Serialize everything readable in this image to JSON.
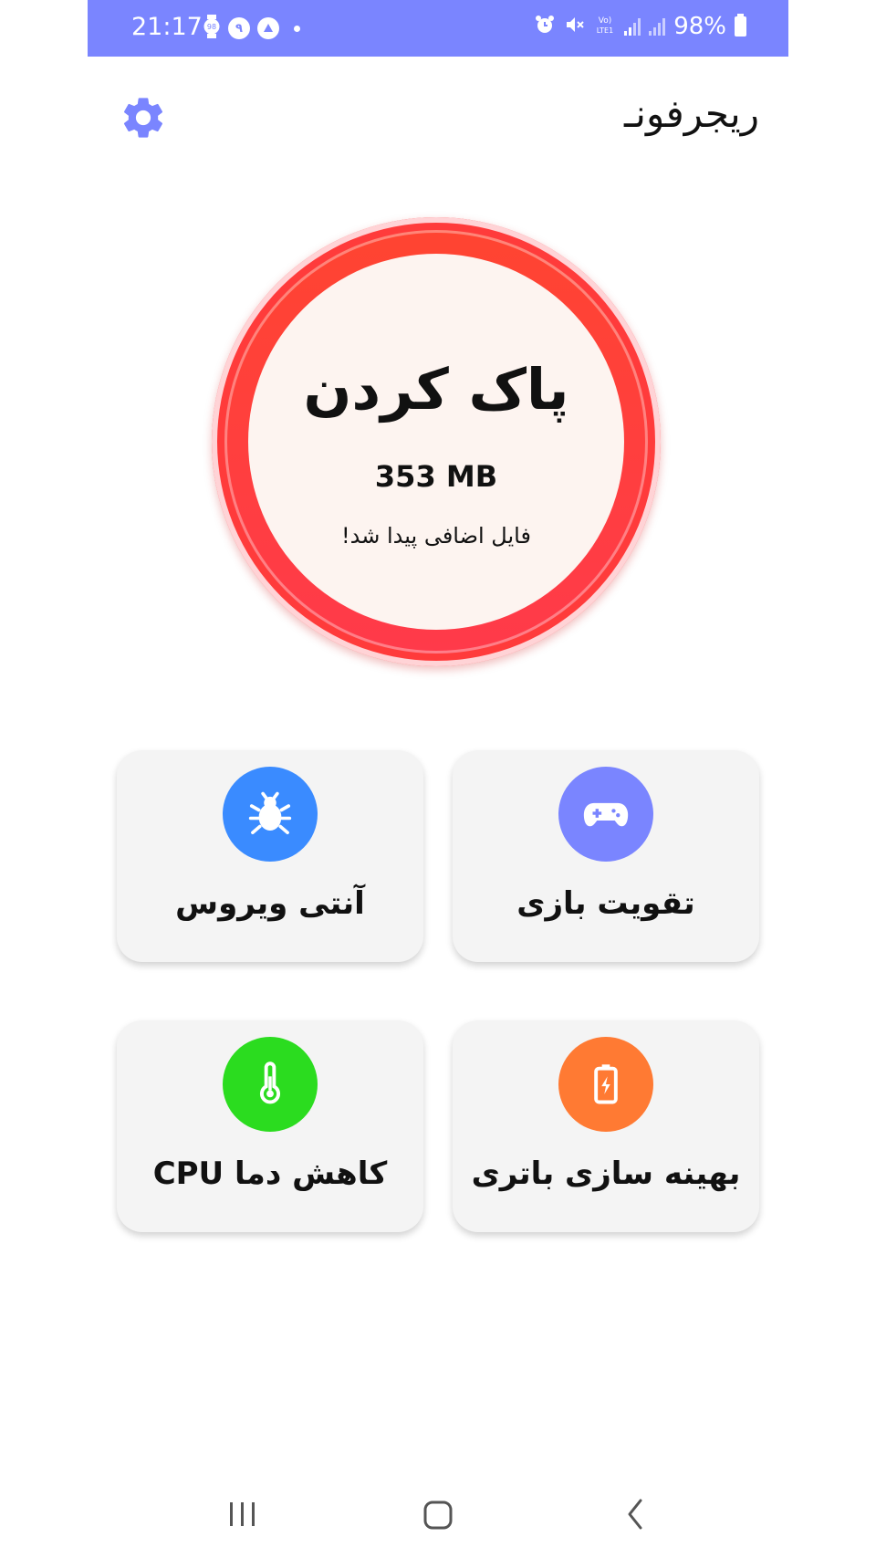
{
  "status_bar": {
    "time": "21:17",
    "battery_percent": "98%",
    "color": "#7a85ff",
    "left_icons": [
      "watch-icon",
      "notification-icon",
      "vpn-icon",
      "dot-icon"
    ],
    "right_icons": [
      "alarm-icon",
      "mute-icon",
      "volte-icon",
      "signal-icon",
      "signal-icon",
      "battery-icon"
    ]
  },
  "header": {
    "title": "ریجرفونـ",
    "settings_icon": "gear-icon",
    "settings_color": "#7a85ff"
  },
  "clean": {
    "title": "پاک کردن",
    "size": "353 MB",
    "subtitle": "فایل اضافی پیدا شد!",
    "ring_color": "#ff3b3b"
  },
  "features": {
    "antivirus": {
      "label": "آنتی ویروس",
      "icon": "bug-icon",
      "color": "#3a8bff"
    },
    "game": {
      "label": "تقویت بازی",
      "icon": "gamepad-icon",
      "color": "#7a85ff"
    },
    "cpu": {
      "label": "کاهش دما CPU",
      "icon": "thermometer-icon",
      "color": "#2bdc1f"
    },
    "battery": {
      "label": "بهینه سازی باتری",
      "icon": "battery-charge-icon",
      "color": "#ff7a33"
    }
  },
  "nav": {
    "recent": "recent-apps-icon",
    "home": "home-icon",
    "back": "back-icon"
  }
}
